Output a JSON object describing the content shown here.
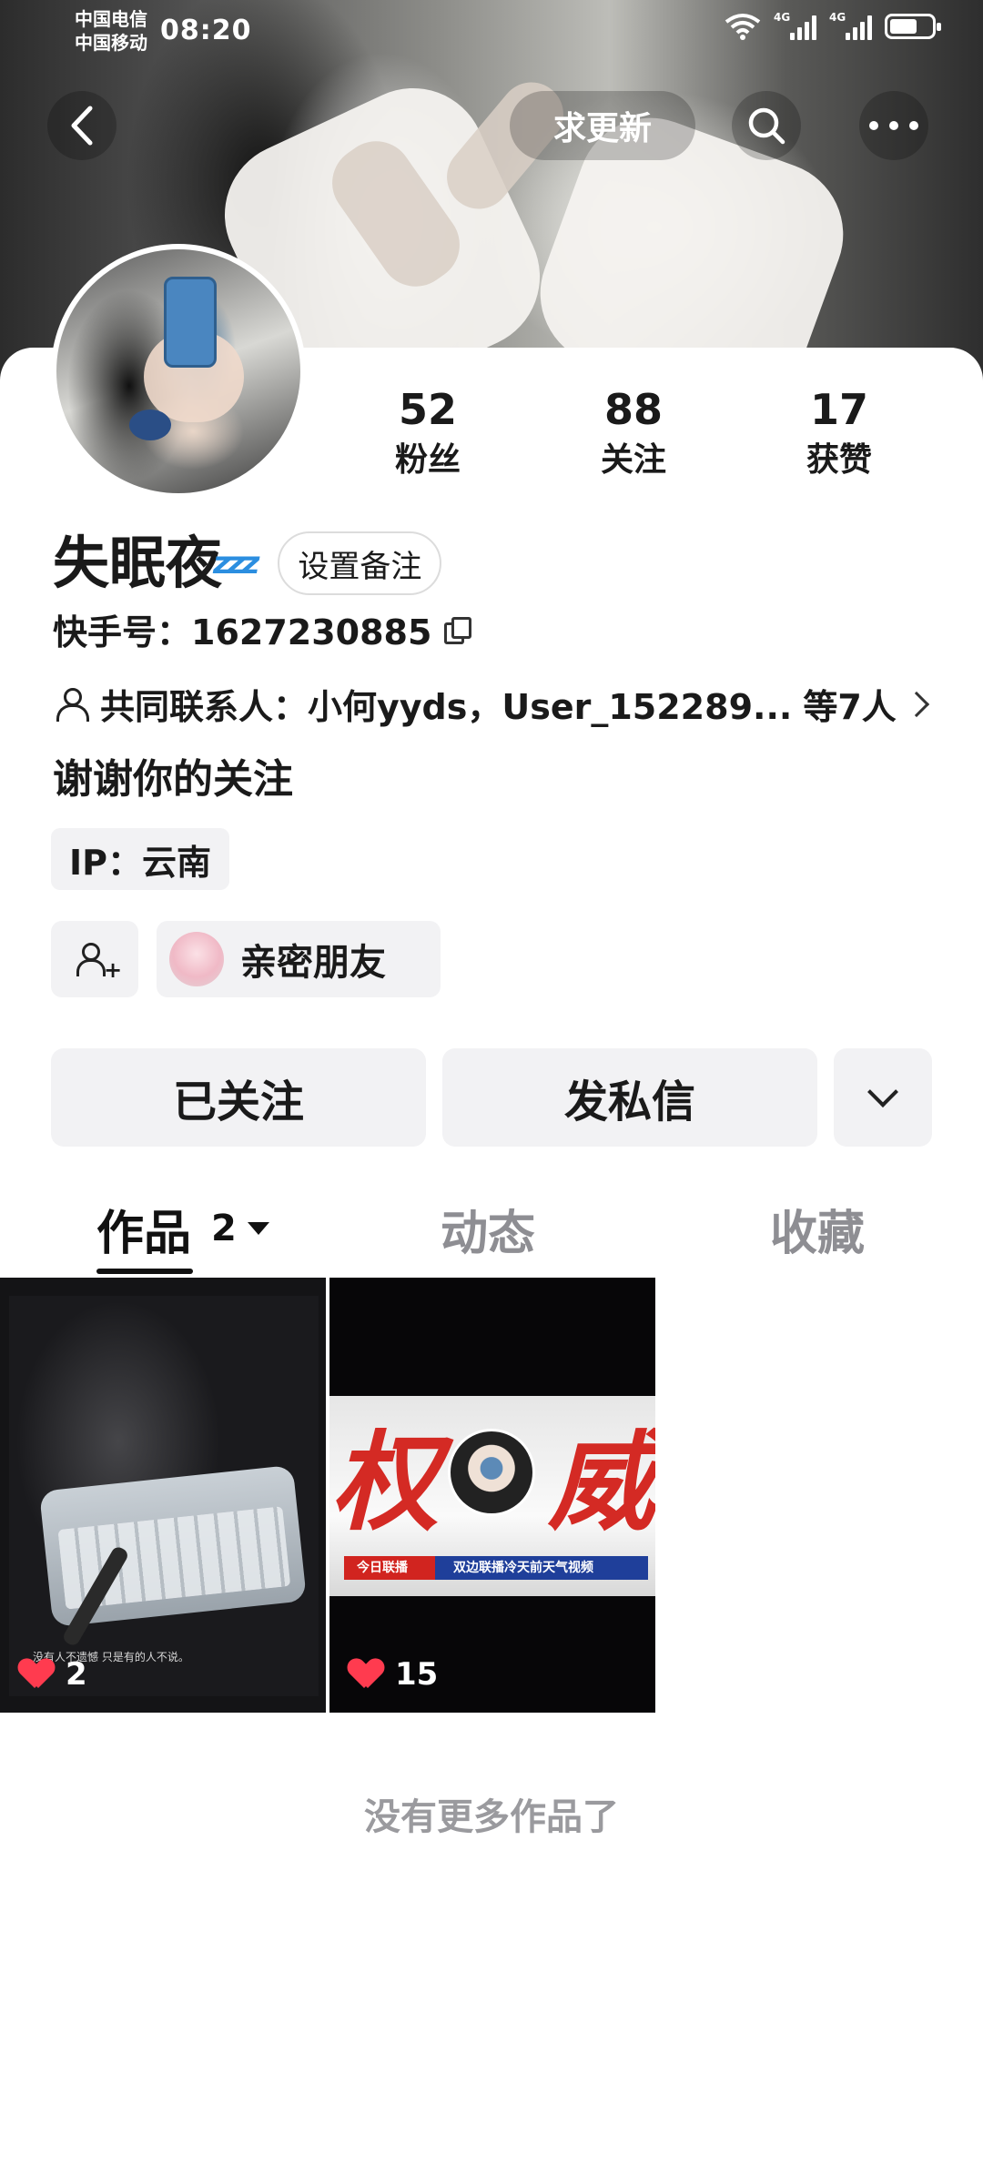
{
  "status_bar": {
    "carrier_1": "中国电信",
    "carrier_2": "中国移动",
    "time": "08:20",
    "signal_1_label": "4G",
    "signal_2_label": "4G",
    "icons": [
      "wifi-icon",
      "signal-icon",
      "signal-icon",
      "battery-icon"
    ]
  },
  "top_bar": {
    "back_icon": "back-arrow-icon",
    "update_button": "求更新",
    "search_icon": "search-icon",
    "more_icon": "more-dots-icon"
  },
  "profile": {
    "stats": [
      {
        "value": "52",
        "label": "粉丝"
      },
      {
        "value": "88",
        "label": "关注"
      },
      {
        "value": "17",
        "label": "获赞"
      }
    ],
    "name": "失眠夜",
    "name_emoji": "zzz",
    "remark_button": "设置备注",
    "kuaishou_id": "快手号：1627230885",
    "mutual_contacts": {
      "label": "共同联系人：",
      "names": "小何yyds，User_152289...",
      "count": "等7人"
    },
    "bio": "谢谢你的关注",
    "ip": "IP：云南",
    "close_friends": "亲密朋友"
  },
  "actions": {
    "followed": "已关注",
    "message": "发私信"
  },
  "tabs": [
    {
      "label": "作品",
      "count": "2",
      "active": true
    },
    {
      "label": "动态",
      "active": false
    },
    {
      "label": "收藏",
      "active": false
    }
  ],
  "works": [
    {
      "likes": "2",
      "caption": "没有人不遗憾 只是有的人不说。"
    },
    {
      "likes": "15",
      "title_left": "权",
      "title_right": "威",
      "ticker_left": "今日联播",
      "ticker_right": "双边联播冷天前天气视频"
    }
  ],
  "footer_text": "没有更多作品了",
  "colors": {
    "accent_blue": "#2b8ee0",
    "heart_red": "#ff3b4f",
    "tab_inactive": "#8e8e93",
    "button_bg": "#f2f2f4"
  }
}
